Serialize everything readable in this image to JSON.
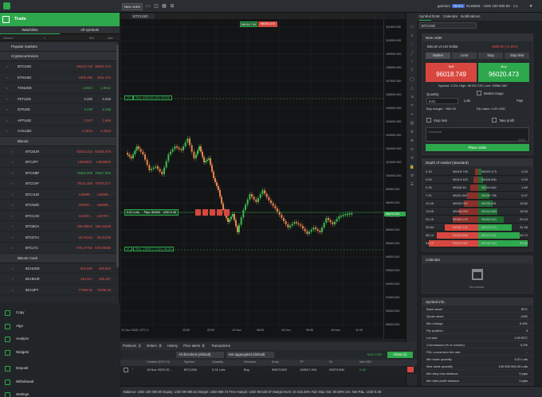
{
  "topbar": {
    "new_order": "New order",
    "account": "gamium",
    "badge": "Demo",
    "balance": "5136603 · USD 100 000.00 · 1:1"
  },
  "left": {
    "trade_label": "Trade",
    "tabs": [
      "Watchlists",
      "All symbols"
    ],
    "search_placeholder": "Search",
    "col_bid": "Bid",
    "col_ask": "Ask",
    "groups": {
      "popular": "Popular markets",
      "crypto": "Cryptocurrencies",
      "bitcoin": "Bitcoin",
      "bitcoin_cash": "Bitcoin Cash"
    },
    "crypto": [
      {
        "name": "BTCUSD",
        "bid": "96018.749",
        "ask": "96020.473",
        "bc": "red",
        "ac": "red"
      },
      {
        "name": "ETHUSD",
        "bid": "3309.486",
        "ask": "3311.370",
        "bc": "red",
        "ac": "red"
      },
      {
        "name": "TONUSD",
        "bid": "1.9324",
        "ask": "1.9512",
        "bc": "grn",
        "ac": "grn"
      },
      {
        "name": "FETUSD",
        "bid": "0.292",
        "ask": "0.293",
        "bc": "n",
        "ac": "n"
      },
      {
        "name": "ICPUSD",
        "bid": "6.230",
        "ask": "6.258",
        "bc": "grn",
        "ac": "grn"
      },
      {
        "name": "APTUSD",
        "bid": "2.947",
        "ask": "2.969",
        "bc": "red",
        "ac": "red"
      },
      {
        "name": "CAKUSD",
        "bid": "2.4634",
        "ask": "2.4643",
        "bc": "red",
        "ac": "red"
      }
    ],
    "bitcoin": [
      {
        "name": "BTCEUR",
        "bid": "91816.310",
        "ask": "91836.978",
        "bc": "red",
        "ac": "red"
      },
      {
        "name": "BTCJPY",
        "bid": "14836927",
        "ask": "14839584",
        "bc": "red",
        "ac": "red"
      },
      {
        "name": "BTCGBP",
        "bid": "75862.909",
        "ask": "75917.684",
        "bc": "grn",
        "ac": "grn"
      },
      {
        "name": "BTCCHF",
        "bid": "79111.380",
        "ask": "79270.277",
        "bc": "red",
        "ac": "red"
      },
      {
        "name": "BTCAUD",
        "bid": "148989...",
        "ask": "148999...",
        "bc": "red",
        "ac": "red"
      },
      {
        "name": "BTCNZD",
        "bid": "165902...",
        "ask": "165986...",
        "bc": "red",
        "ac": "red"
      },
      {
        "name": "BTCCAD",
        "bid": "134631...",
        "ask": "134797...",
        "bc": "red",
        "ac": "red"
      },
      {
        "name": "BTCBCH",
        "bid": "185.09944",
        "ask": "185.30349",
        "bc": "red",
        "ac": "red"
      },
      {
        "name": "BTCETH",
        "bid": "29.00224",
        "ask": "29.01336",
        "bc": "red",
        "ac": "red"
      },
      {
        "name": "BTCLTC",
        "bid": "979.27782",
        "ask": "979.59085",
        "bc": "red",
        "ac": "red"
      }
    ],
    "bch": [
      {
        "name": "BCHUSD",
        "bid": "504.060",
        "ask": "505.824",
        "bc": "red",
        "ac": "red"
      },
      {
        "name": "BCHEUR",
        "bid": "416.317",
        "ask": "495.187",
        "bc": "red",
        "ac": "red"
      },
      {
        "name": "BCHJPY",
        "bid": "77969.82",
        "ask": "78206.29",
        "bc": "red",
        "ac": "red"
      }
    ],
    "menu": [
      "Copy",
      "Algo",
      "Analyze",
      "Widgets",
      "Deposit",
      "Withdrawal",
      "Settings"
    ]
  },
  "chart": {
    "symbol": "BTCUSD",
    "date_label": "12 Nov 2025, UTC+1",
    "yticks": [
      "111000.000",
      "110000.000",
      "109000.000",
      "108000.000",
      "107000.000",
      "106000.000",
      "105000.000",
      "104000.000",
      "103000.000",
      "102000.000",
      "101000.000",
      "100000.000",
      "99000.000",
      "98000.000",
      "97000.000",
      "96000.000",
      "95000.000",
      "94000.000",
      "93000.000",
      "92000.000",
      "91000.000",
      "90000.000",
      "89000.000"
    ],
    "xticks": [
      "13:00",
      "22:00",
      "14 Nov",
      "08:00",
      "16 Nov",
      "06:00",
      "18 Nov",
      "11:00"
    ],
    "price_sell": "96018.749",
    "price_buy": "96020.473",
    "last_price": "96670.000",
    "pos_label": "0.01 Lots",
    "pos_pnl": "Pips: 80345",
    "pos_usd": "USD 0.45",
    "tp_label": "TP",
    "sl_label": "SL",
    "tp_text": "Pips: 4088.52  USD 105.08",
    "sl_text": "Pips: -29850.77  USD -98.08"
  },
  "bottom": {
    "tabs": [
      "Positions",
      "Orders",
      "History",
      "Price alerts",
      "Transactions"
    ],
    "tab_counts": [
      "1",
      "0",
      "",
      "0",
      ""
    ],
    "filter1": "All directions (default)",
    "filter2": "Not aggregated (default)",
    "new_order": "New order",
    "close": "Close (1)",
    "columns": [
      "Created (UTC+1)",
      "Symbol",
      "Quantity",
      "Direction",
      "Entry",
      "TP",
      "SL",
      "Net USD"
    ],
    "row": [
      "15 Nov 2025 20...",
      "BTCUSD",
      "0.01 Lots",
      "Buy",
      "95873.500",
      "100617.434",
      "93373.500",
      "0.45"
    ],
    "balance_bar": "Balance: USD 100 000.00    Equity: USD 99 590.61    Margin: USD 959.74    Free margin: USD 98 630.87    Margin level: 10 416.34%    Fair Stop Out: 90.00%    Unr. Net P&L: USD 0.45"
  },
  "right": {
    "tabs": [
      "Symbol",
      "DoM",
      "Calendar",
      "Notifications"
    ],
    "symbol_select": "BTCUSD",
    "new_order": "New order",
    "title": "Bitcoin vs US Dollar",
    "change": "-6296.00 (-6.13%)",
    "order_types": [
      "Market",
      "Limit",
      "Stop",
      "Stop limit"
    ],
    "sell_label": "Sell",
    "buy_label": "Buy",
    "sell_price": "96018.749",
    "buy_price": "96020.473",
    "spread": "Spread: 1724; High: 96782.749; Low: 93984.382",
    "quantity_label": "Quantity",
    "quantity_value": "0.01",
    "unit": "Lots",
    "market_range": "Market range",
    "pips": "Pips",
    "buy_margin": "Buy margin: ~960.20",
    "pip_value": "Pip value: 0.00 USD",
    "stop_loss": "Stop loss",
    "take_profit": "Take profit",
    "comment_placeholder": "Comment",
    "char_count": "0/100",
    "place_order": "Place order",
    "dom_title": "Depth of market (standard)",
    "dom_rows": [
      [
        "0.15",
        "96018.749",
        "96020.473",
        "0.20"
      ],
      [
        "0.60",
        "96013.323",
        "96026.800",
        "0.53"
      ],
      [
        "0.30",
        "96008.30",
        "96024.662",
        "1.80"
      ],
      [
        "7.91",
        "96001.867",
        "96026.736",
        "6.97"
      ],
      [
        "10.45",
        "96000.052",
        "96035.651",
        "10.82"
      ],
      [
        "13.05",
        "95995.093",
        "96044.683",
        "15.05"
      ],
      [
        "20.15",
        "95989.076",
        "96055.824",
        "20.24"
      ],
      [
        "39.84",
        "95955.131",
        "96079.270",
        "31.36"
      ],
      [
        "48.14",
        "95943.850",
        "96107.221",
        "40.72"
      ],
      [
        "94.10",
        "95875.961",
        "96130.263",
        "93.88"
      ]
    ],
    "calendar_title": "Calendar",
    "no_events": "No events",
    "info_title": "Symbol info",
    "info": [
      [
        "Base asset",
        "BTC"
      ],
      [
        "Quote asset",
        "USD"
      ],
      [
        "Min change",
        "0.001"
      ],
      [
        "Pip position",
        "3"
      ],
      [
        "Lot size",
        "1.00 BTC"
      ],
      [
        "Commission (% of volume)",
        "0.2%"
      ],
      [
        "P&L conversion fee rate",
        "-"
      ],
      [
        "Min trade quantity",
        "0.01 Lots"
      ],
      [
        "Max trade quantity",
        "100 000 000.00 Lots"
      ],
      [
        "Min step-loss distance",
        "0 pips"
      ],
      [
        "Min take-profit distance",
        "0 pips"
      ]
    ]
  },
  "colors": {
    "green": "#2ea84c",
    "red": "#d8473f",
    "bg": "#131416"
  }
}
